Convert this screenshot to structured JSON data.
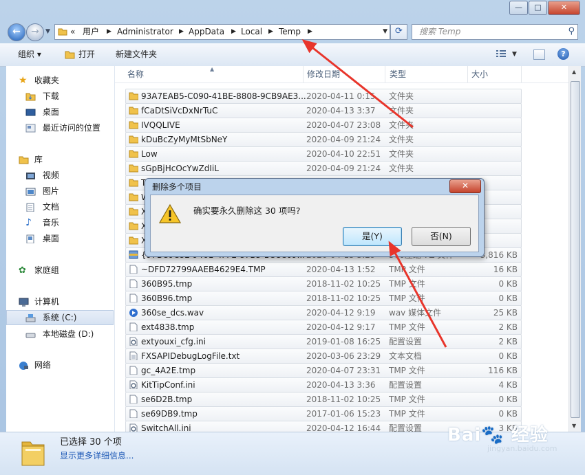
{
  "window": {
    "controls": {
      "minimize": "—",
      "maximize": "□",
      "close": "✕"
    }
  },
  "address": {
    "crumbs": [
      "用户",
      "Administrator",
      "AppData",
      "Local",
      "Temp"
    ],
    "overflow": "«",
    "search_placeholder": "搜索 Temp"
  },
  "toolbar": {
    "organize": "组织 ▾",
    "open": "打开",
    "new_folder": "新建文件夹"
  },
  "sidebar": {
    "favorites": {
      "label": "收藏夹",
      "items": [
        "下载",
        "桌面",
        "最近访问的位置"
      ]
    },
    "libraries": {
      "label": "库",
      "items": [
        "视频",
        "图片",
        "文档",
        "音乐",
        "桌面"
      ]
    },
    "homegroup": "家庭组",
    "computer": {
      "label": "计算机",
      "items": [
        "系统 (C:)",
        "本地磁盘 (D:)"
      ]
    },
    "network": "网络"
  },
  "columns": {
    "name": "名称",
    "date": "修改日期",
    "type": "类型",
    "size": "大小"
  },
  "files": [
    {
      "icon": "folder",
      "name": "93A7EAB5-C090-41BE-8808-9CB9AE3...",
      "date": "2020-04-11 0:15",
      "type": "文件夹",
      "size": ""
    },
    {
      "icon": "folder",
      "name": "fCaDtSiVcDxNrTuC",
      "date": "2020-04-13 3:37",
      "type": "文件夹",
      "size": ""
    },
    {
      "icon": "folder",
      "name": "IVQQLIVE",
      "date": "2020-04-07 23:08",
      "type": "文件夹",
      "size": ""
    },
    {
      "icon": "folder",
      "name": "kDuBcZyMyMtSbNeY",
      "date": "2020-04-09 21:24",
      "type": "文件夹",
      "size": ""
    },
    {
      "icon": "folder",
      "name": "Low",
      "date": "2020-04-10 22:51",
      "type": "文件夹",
      "size": ""
    },
    {
      "icon": "folder",
      "name": "sGpBjHcOcYwZdIiL",
      "date": "2020-04-09 21:24",
      "type": "文件夹",
      "size": ""
    },
    {
      "icon": "folder",
      "name": "Tl",
      "date": "",
      "type": "",
      "size": ""
    },
    {
      "icon": "folder",
      "name": "W",
      "date": "",
      "type": "",
      "size": ""
    },
    {
      "icon": "folder",
      "name": "XI",
      "date": "",
      "type": "",
      "size": ""
    },
    {
      "icon": "folder",
      "name": "XI",
      "date": "",
      "type": "",
      "size": ""
    },
    {
      "icon": "folder",
      "name": "Xi",
      "date": "",
      "type": "",
      "size": ""
    },
    {
      "icon": "zip",
      "name": "{97BC0C8E-9461-4FFE-87B3-1CCC09...",
      "date": "2020-04-13 3:29",
      "type": "360压缩 7Z 文件",
      "size": "3,816 KB"
    },
    {
      "icon": "file",
      "name": "~DFD72799AAEB4629E4.TMP",
      "date": "2020-04-13 1:52",
      "type": "TMP 文件",
      "size": "16 KB"
    },
    {
      "icon": "file",
      "name": "360B95.tmp",
      "date": "2018-11-02 10:25",
      "type": "TMP 文件",
      "size": "0 KB"
    },
    {
      "icon": "file",
      "name": "360B96.tmp",
      "date": "2018-11-02 10:25",
      "type": "TMP 文件",
      "size": "0 KB"
    },
    {
      "icon": "audio",
      "name": "360se_dcs.wav",
      "date": "2020-04-12 9:19",
      "type": "wav 媒体文件",
      "size": "25 KB"
    },
    {
      "icon": "file",
      "name": "ext4838.tmp",
      "date": "2020-04-12 9:17",
      "type": "TMP 文件",
      "size": "2 KB"
    },
    {
      "icon": "config",
      "name": "extyouxi_cfg.ini",
      "date": "2019-01-08 16:25",
      "type": "配置设置",
      "size": "2 KB"
    },
    {
      "icon": "text",
      "name": "FXSAPIDebugLogFile.txt",
      "date": "2020-03-06 23:29",
      "type": "文本文档",
      "size": "0 KB"
    },
    {
      "icon": "file",
      "name": "gc_4A2E.tmp",
      "date": "2020-04-07 23:31",
      "type": "TMP 文件",
      "size": "116 KB"
    },
    {
      "icon": "config",
      "name": "KitTipConf.ini",
      "date": "2020-04-13 3:36",
      "type": "配置设置",
      "size": "4 KB"
    },
    {
      "icon": "file",
      "name": "se6D2B.tmp",
      "date": "2018-11-02 10:25",
      "type": "TMP 文件",
      "size": "0 KB"
    },
    {
      "icon": "file",
      "name": "se69DB9.tmp",
      "date": "2017-01-06 15:23",
      "type": "TMP 文件",
      "size": "0 KB"
    },
    {
      "icon": "config",
      "name": "SwitchAll.ini",
      "date": "2020-04-12 16:44",
      "type": "配置设置",
      "size": "3 KB"
    }
  ],
  "status": {
    "selected": "已选择 30 个项",
    "details_link": "显示更多详细信息..."
  },
  "dialog": {
    "title": "删除多个项目",
    "message": "确实要永久删除这 30 项吗?",
    "yes": "是(Y)",
    "no": "否(N)",
    "close": "✕"
  },
  "watermark": {
    "main": "Bai🐾 经验",
    "sub": "jingyan.baidu.com"
  },
  "colors": {
    "arrow": "#e8352b",
    "link": "#1c58b6",
    "folder": "#f0c24b"
  }
}
